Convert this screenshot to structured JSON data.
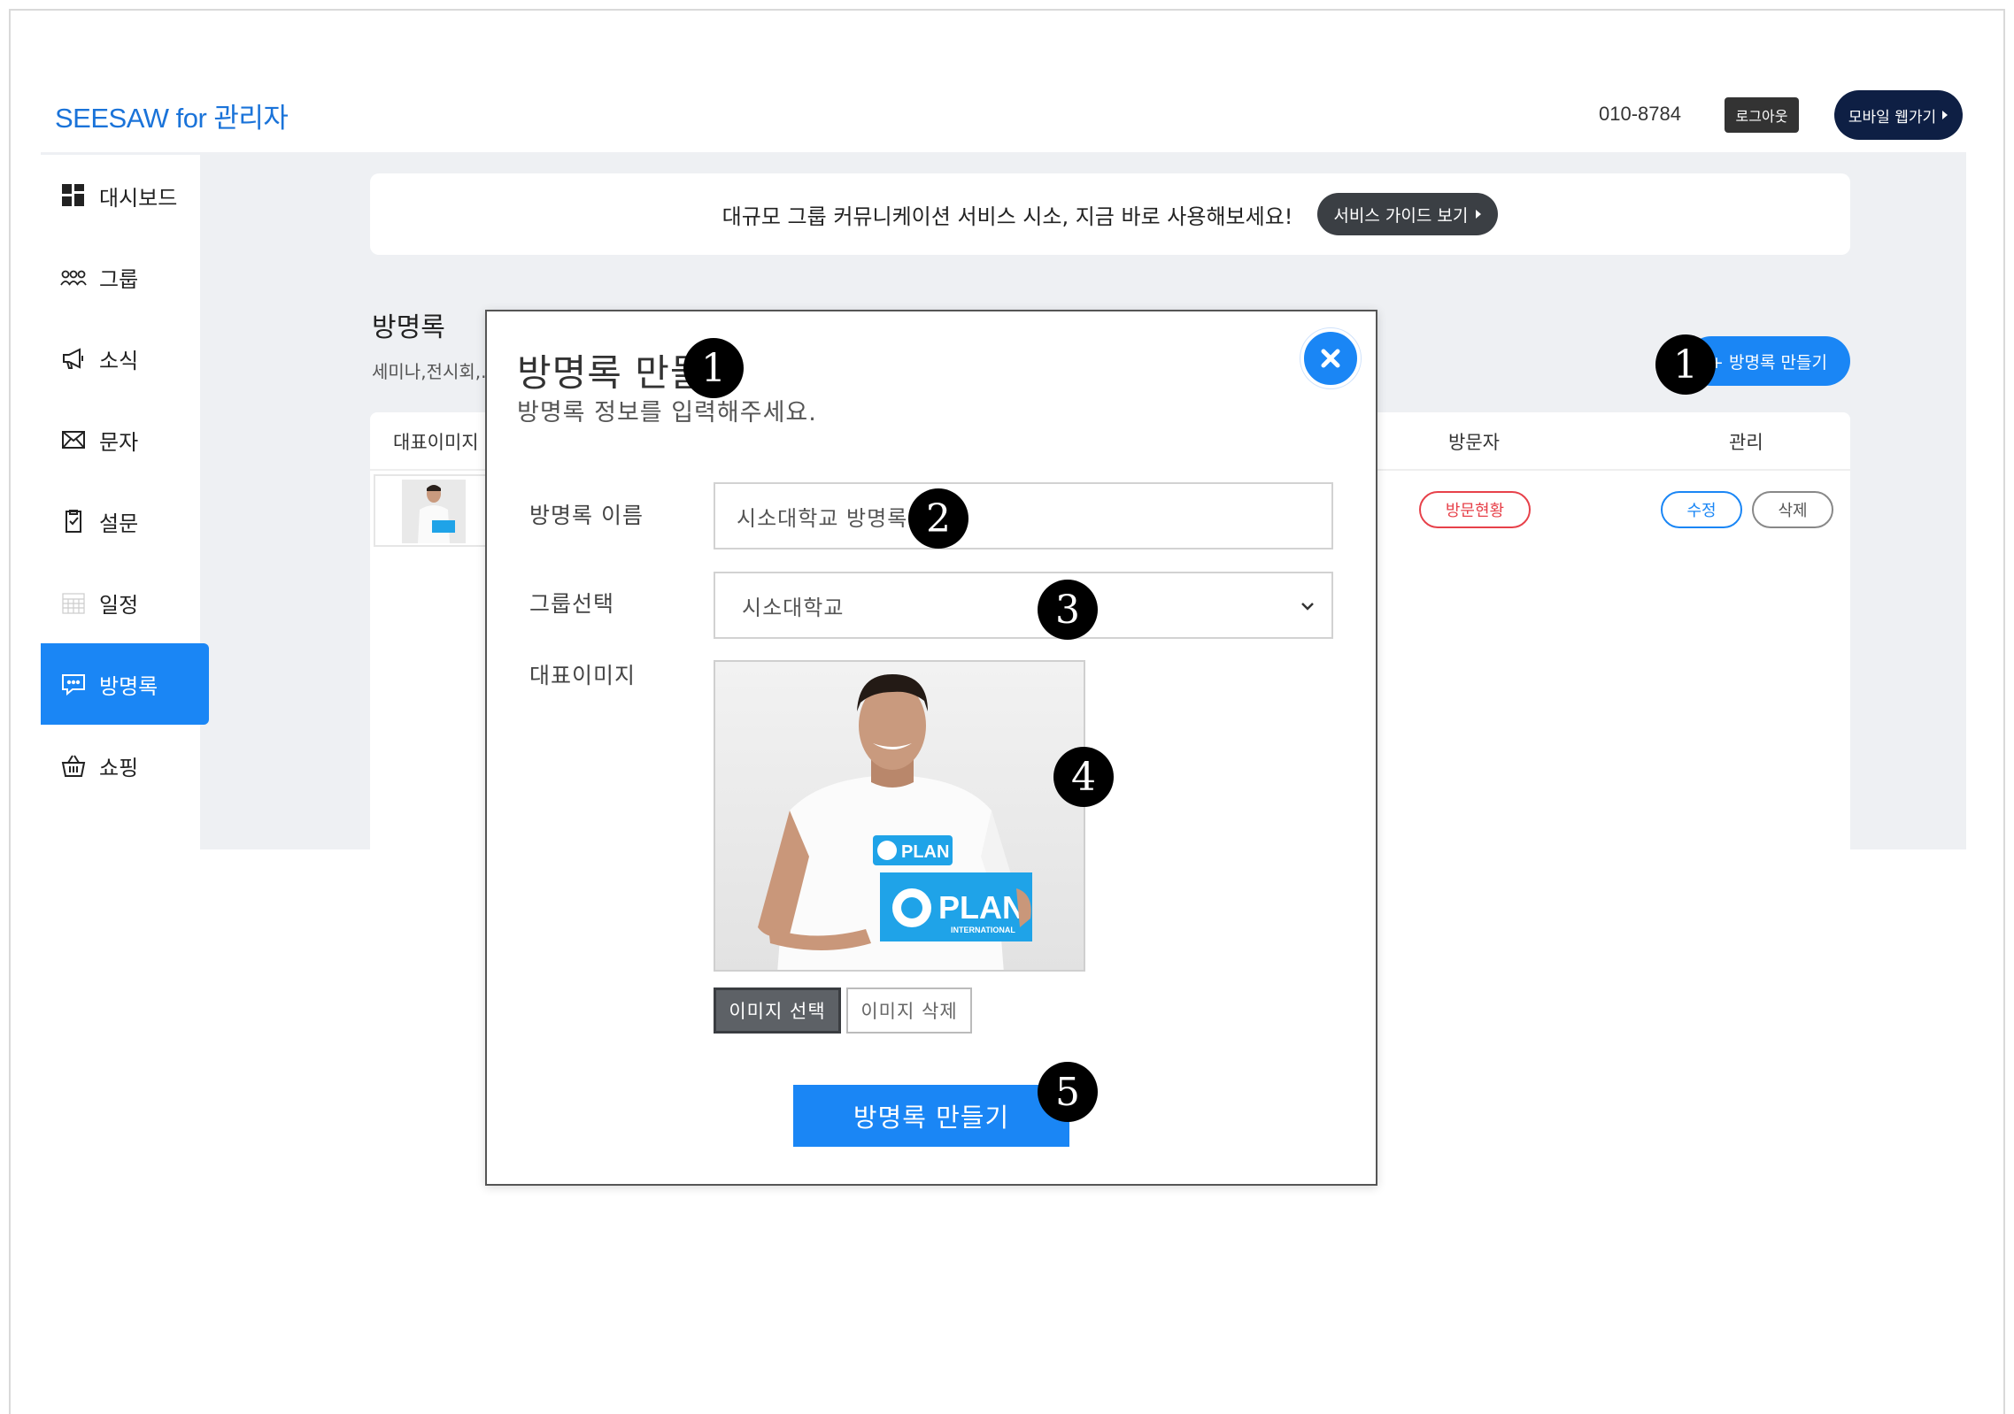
{
  "header": {
    "brand": "SEESAW for 관리자",
    "phone": "010-8784",
    "logout_label": "로그아웃",
    "mobile_label": "모바일 웹가기"
  },
  "sidebar": {
    "items": [
      {
        "label": "대시보드",
        "icon": "dashboard-icon"
      },
      {
        "label": "그룹",
        "icon": "group-icon"
      },
      {
        "label": "소식",
        "icon": "megaphone-icon"
      },
      {
        "label": "문자",
        "icon": "mail-icon"
      },
      {
        "label": "설문",
        "icon": "survey-icon"
      },
      {
        "label": "일정",
        "icon": "calendar-icon"
      },
      {
        "label": "방명록",
        "icon": "guestbook-icon",
        "active": true
      },
      {
        "label": "쇼핑",
        "icon": "basket-icon"
      }
    ]
  },
  "banner": {
    "text": "대규모 그룹 커뮤니케이션 서비스 시소, 지금 바로 사용해보세요!",
    "guide_label": "서비스 가이드 보기"
  },
  "main": {
    "title": "방명록",
    "description": "세미나,전시회,...",
    "create_label": "+ 방명록 만들기",
    "table": {
      "headers": [
        "대표이미지",
        "방문자",
        "관리"
      ],
      "rows": [
        {
          "visit_label": "방문현황",
          "edit_label": "수정",
          "delete_label": "삭제"
        }
      ]
    }
  },
  "modal": {
    "title": "방명록 만들기",
    "subtitle": "방명록 정보를 입력해주세요.",
    "name_label": "방명록 이름",
    "name_value": "시소대학교 방명록",
    "group_label": "그룹선택",
    "group_value": "시소대학교",
    "image_label": "대표이미지",
    "photo_sign_top": "PLAN",
    "photo_sign": "PLAN",
    "photo_sign_sub": "INTERNATIONAL",
    "select_image_label": "이미지 선택",
    "delete_image_label": "이미지 삭제",
    "submit_label": "방명록 만들기"
  },
  "markers": [
    "1",
    "1",
    "2",
    "3",
    "4",
    "5"
  ],
  "colors": {
    "accent": "#1a86f5",
    "navy": "#0e1f44",
    "danger": "#e7414a",
    "content_bg": "#eef0f3"
  }
}
